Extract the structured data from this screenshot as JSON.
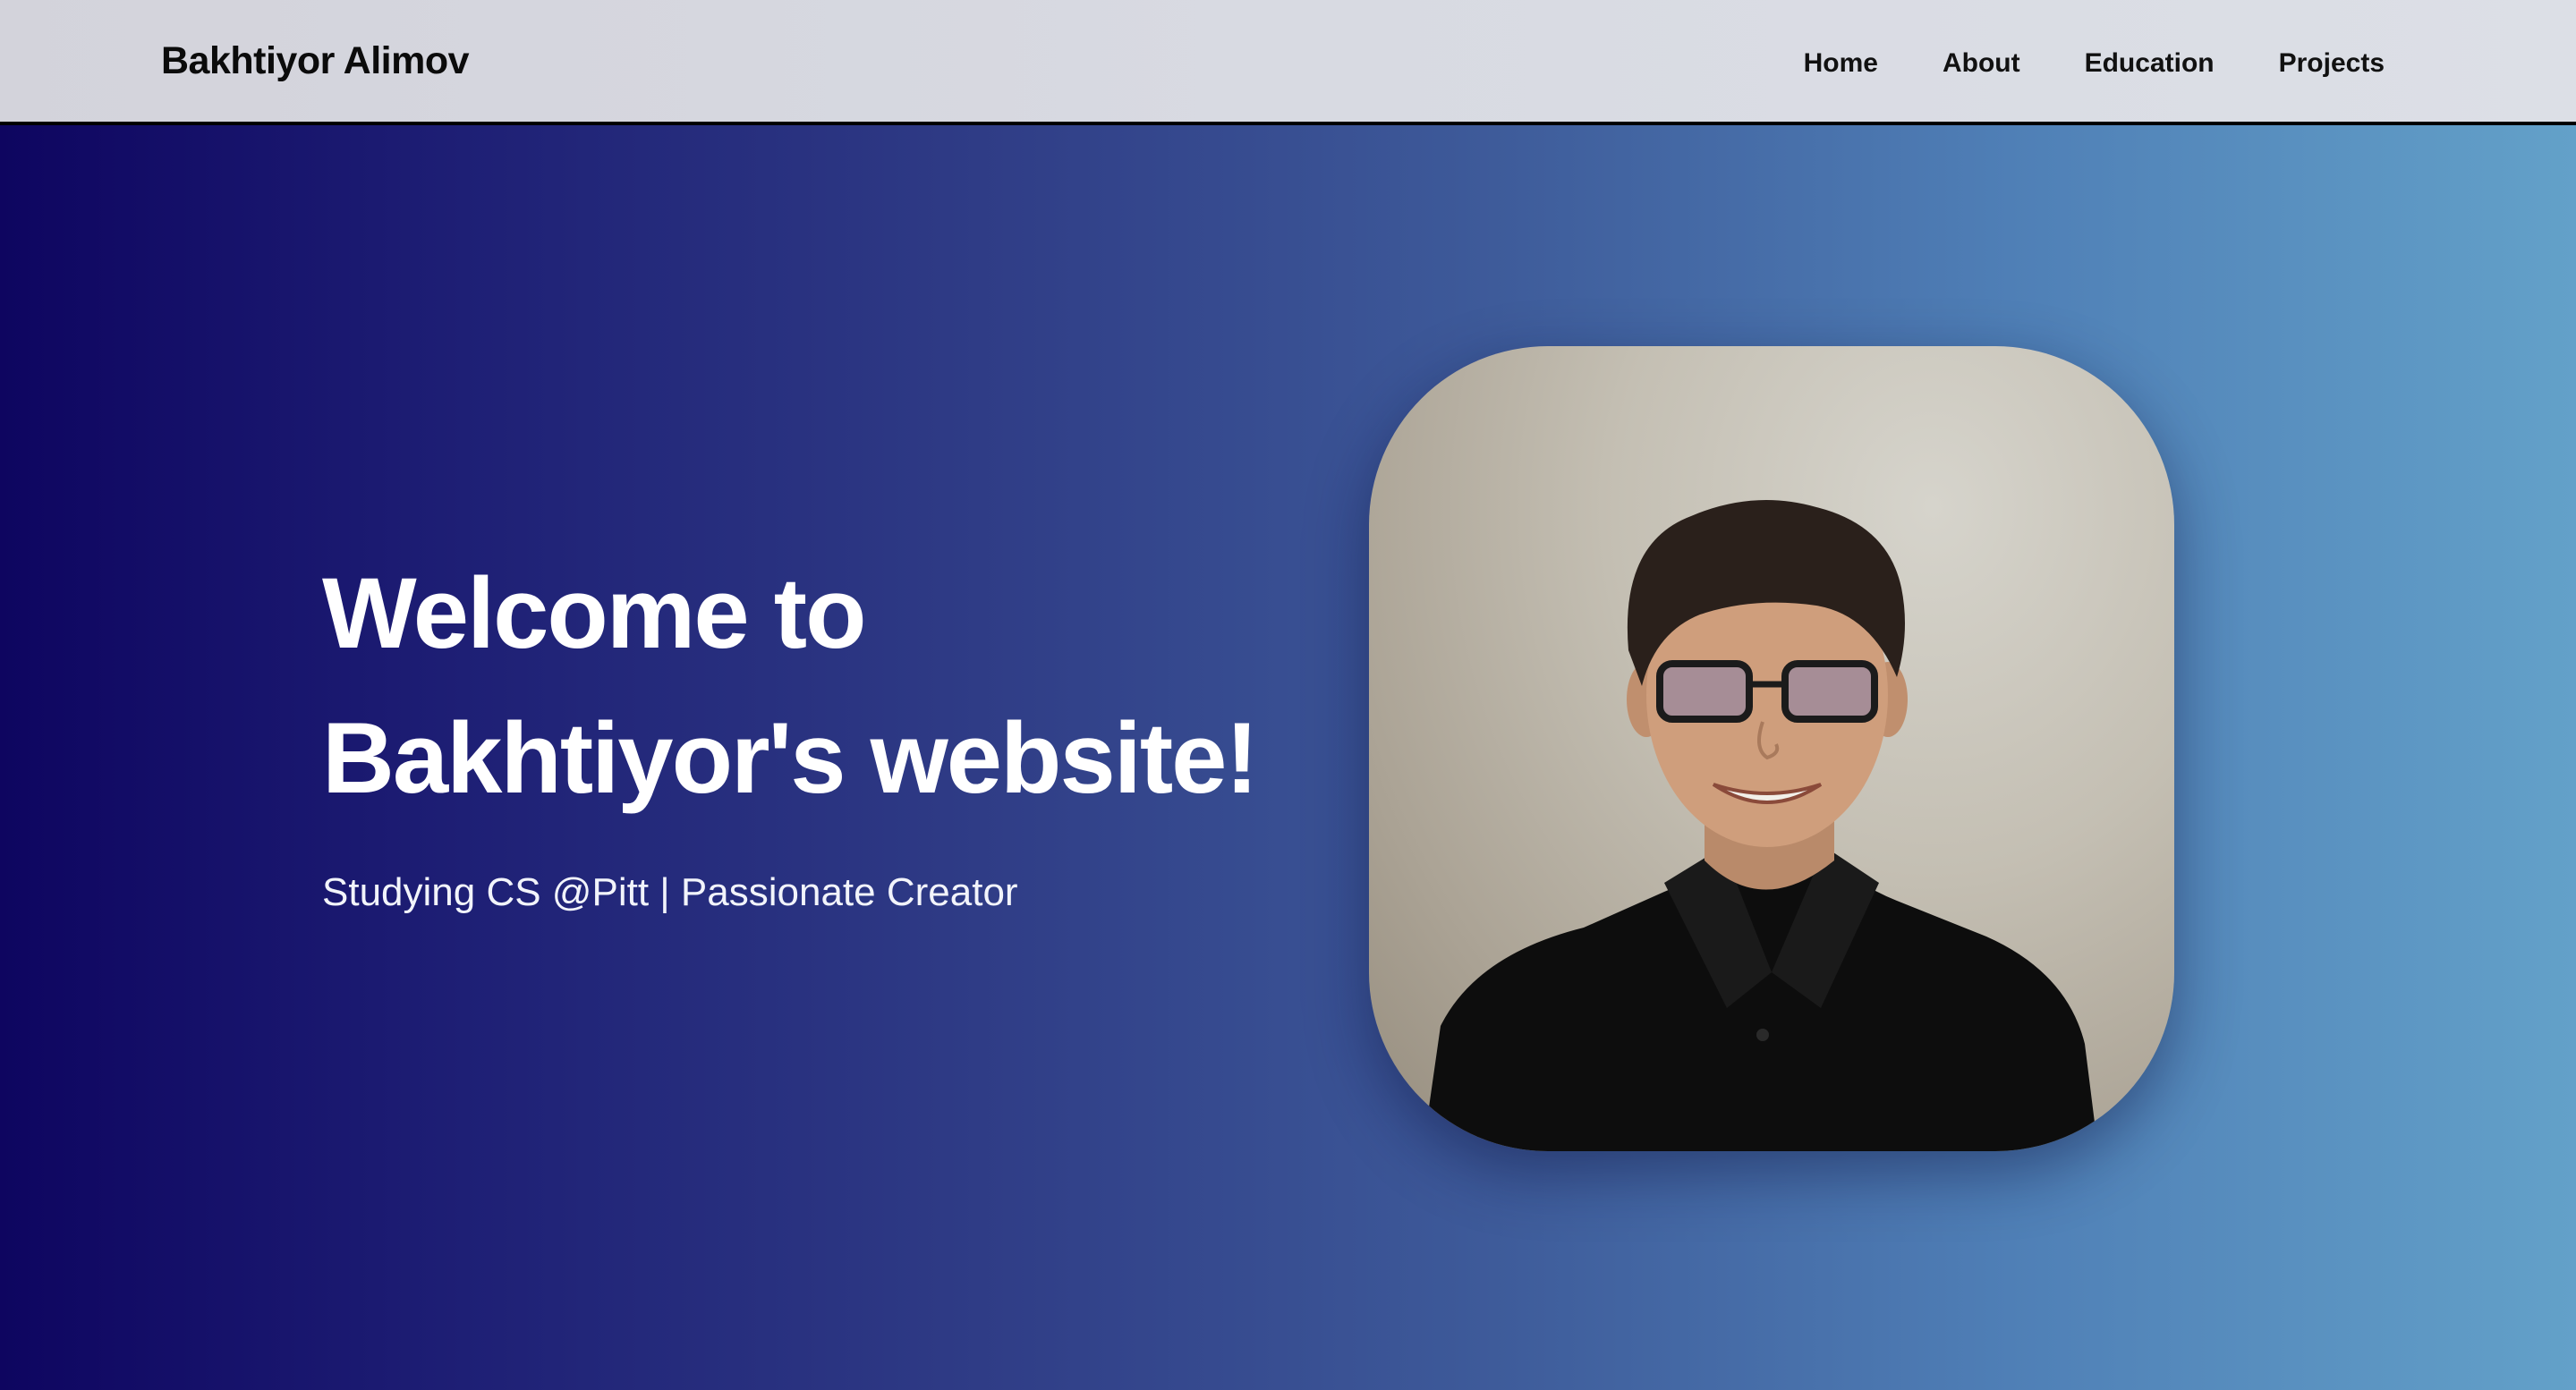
{
  "navbar": {
    "brand": "Bakhtiyor Alimov",
    "links": [
      {
        "label": "Home"
      },
      {
        "label": "About"
      },
      {
        "label": "Education"
      },
      {
        "label": "Projects"
      }
    ]
  },
  "hero": {
    "title_line1": "Welcome to",
    "title_line2": "Bakhtiyor's website!",
    "subtitle": "Studying CS @Pitt | Passionate Creator"
  },
  "colors": {
    "gradient_start": "#0e0560",
    "gradient_end": "#63a1c9",
    "navbar_bg": "#d8dae2",
    "text_light": "#ffffff",
    "text_dark": "#111111"
  }
}
